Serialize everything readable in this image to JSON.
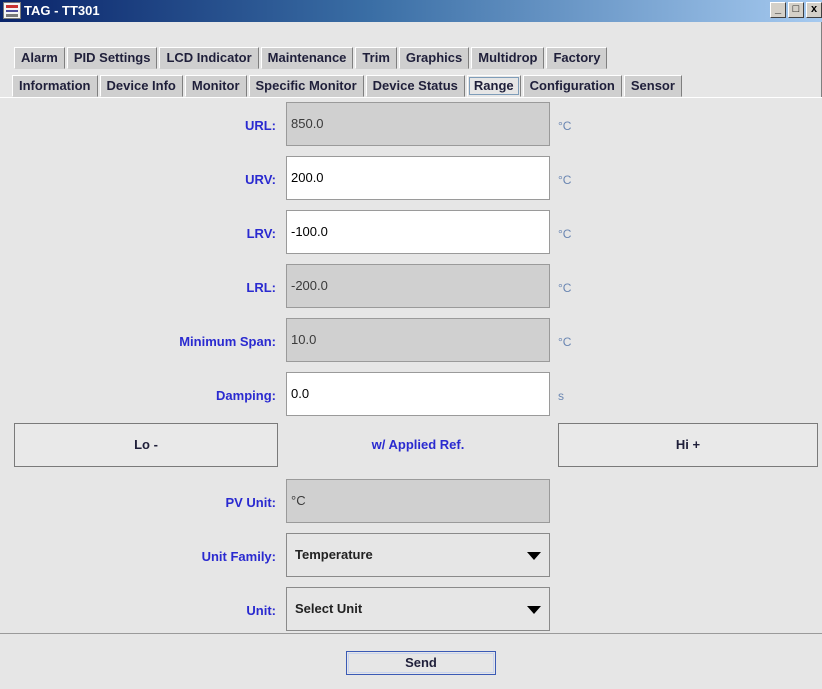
{
  "window": {
    "title": "TAG - TT301",
    "controls": [
      "_",
      "□",
      "x"
    ]
  },
  "tabs_row1": [
    "Alarm",
    "PID Settings",
    "LCD Indicator",
    "Maintenance",
    "Trim",
    "Graphics",
    "Multidrop",
    "Factory"
  ],
  "tabs_row2": [
    "Information",
    "Device Info",
    "Monitor",
    "Specific Monitor",
    "Device Status",
    "Range",
    "Configuration",
    "Sensor"
  ],
  "active_tab": "Range",
  "fields": {
    "url": {
      "label": "URL:",
      "value": "850.0",
      "unit": "°C"
    },
    "urv": {
      "label": "URV:",
      "value": "200.0",
      "unit": "°C"
    },
    "lrv": {
      "label": "LRV:",
      "value": "-100.0",
      "unit": "°C"
    },
    "lrl": {
      "label": "LRL:",
      "value": "-200.0",
      "unit": "°C"
    },
    "min_span": {
      "label": "Minimum Span:",
      "value": "10.0",
      "unit": "°C"
    },
    "damping": {
      "label": "Damping:",
      "value": "0.0",
      "unit": "s"
    }
  },
  "applied_ref": {
    "lo_button": "Lo -",
    "label": "w/ Applied Ref.",
    "hi_button": "Hi +"
  },
  "pv_unit": {
    "label": "PV Unit:",
    "value": "°C"
  },
  "unit_family": {
    "label": "Unit Family:",
    "selected": "Temperature"
  },
  "unit": {
    "label": "Unit:",
    "selected": "Select Unit"
  },
  "send_label": "Send",
  "colors": {
    "label_blue": "#2a2ad0",
    "titlebar_start": "#0a246a",
    "titlebar_end": "#a6caf0"
  }
}
